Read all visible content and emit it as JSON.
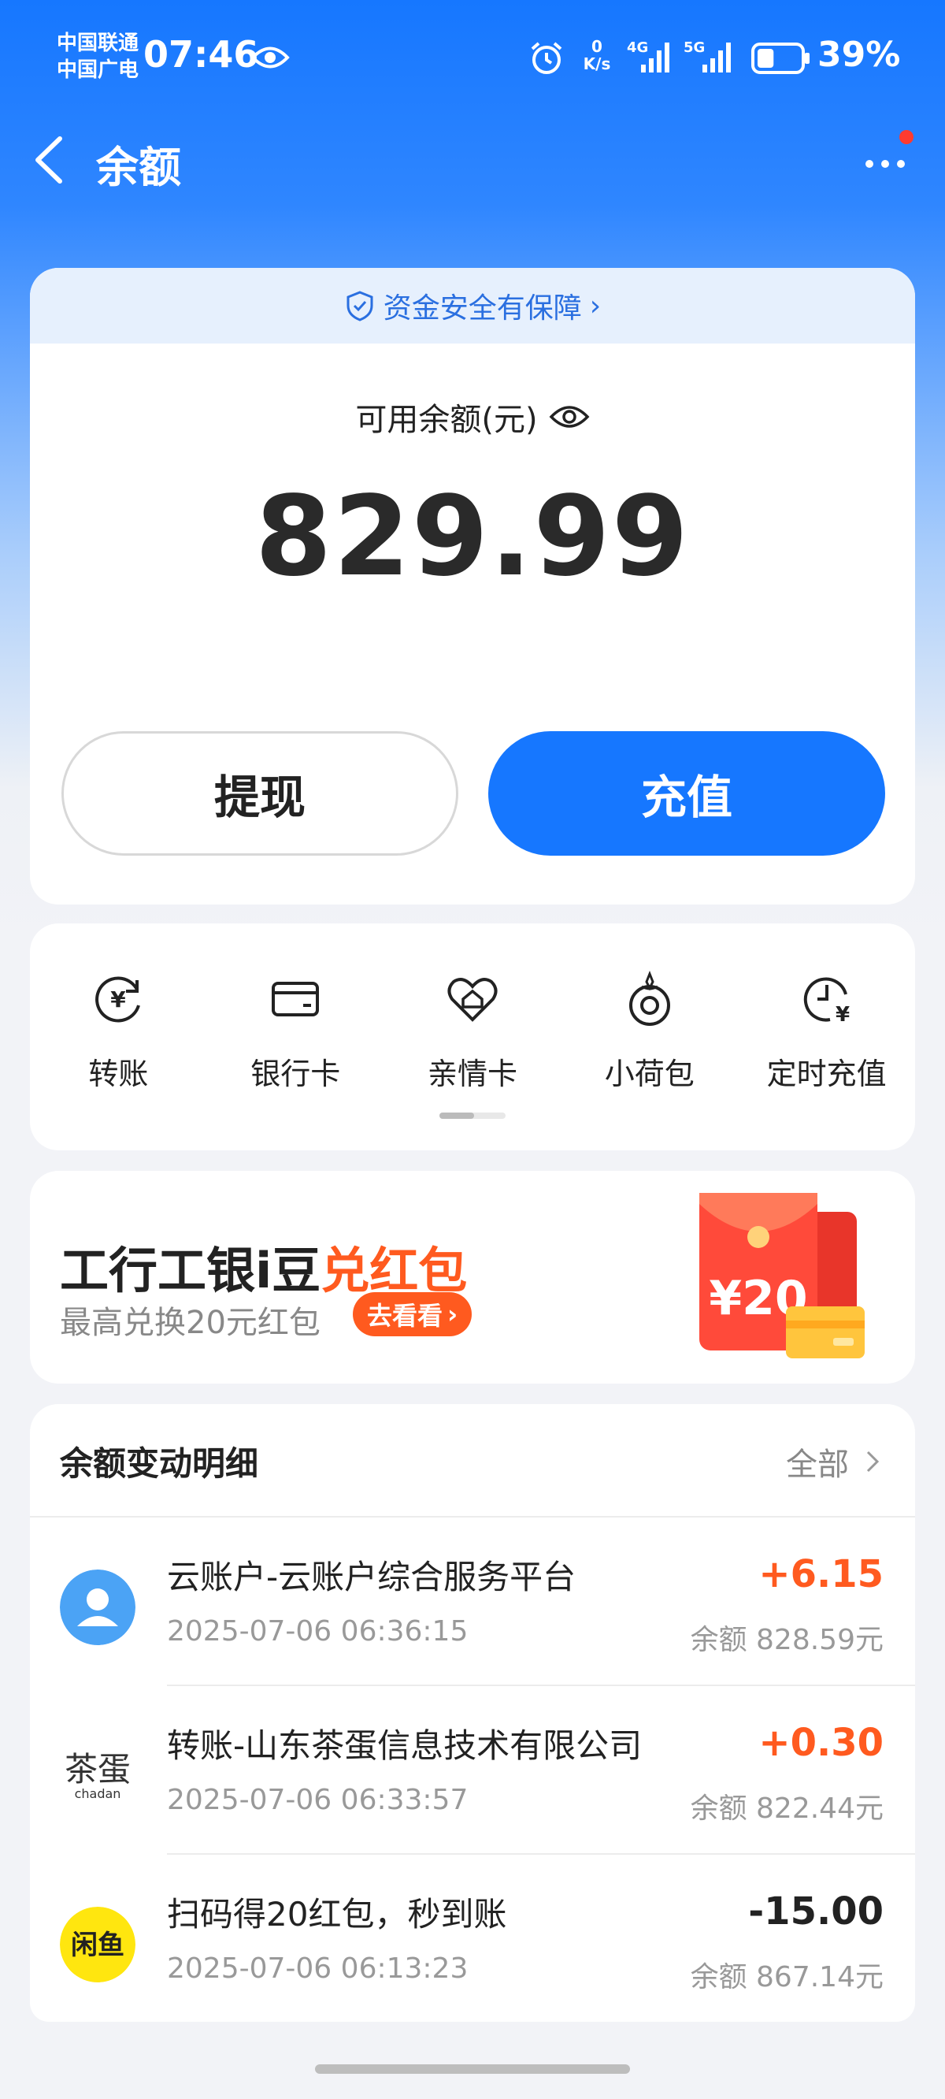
{
  "status_bar": {
    "carrier_1": "中国联通",
    "carrier_2": "中国广电",
    "time": "07:46",
    "net_speed_value": "0",
    "net_speed_unit": "K/s",
    "network_1": "4G",
    "network_2": "5G",
    "battery": "39%",
    "battery_level": 0.39
  },
  "nav": {
    "title": "余额",
    "back_icon": "back-chevron-icon",
    "more_icon": "more-dots-icon",
    "has_notification": true
  },
  "balance": {
    "security_label": "资金安全有保障",
    "label": "可用余额(元)",
    "amount": "829.99",
    "withdraw_label": "提现",
    "topup_label": "充值"
  },
  "actions": [
    {
      "label": "转账",
      "icon": "transfer-icon"
    },
    {
      "label": "银行卡",
      "icon": "bank-card-icon"
    },
    {
      "label": "亲情卡",
      "icon": "family-card-icon"
    },
    {
      "label": "小荷包",
      "icon": "small-purse-icon"
    },
    {
      "label": "定时充值",
      "icon": "scheduled-topup-icon"
    }
  ],
  "promo": {
    "title_main": "工行工银i豆",
    "title_highlight": "兑红包",
    "subtitle": "最高兑换20元红包",
    "cta": "去看看",
    "envelope_amount": "¥20"
  },
  "transactions": {
    "header": "余额变动明细",
    "all_label": "全部",
    "items": [
      {
        "title": "云账户-云账户综合服务平台",
        "time": "2025-07-06 06:36:15",
        "amount": "+6.15",
        "balance": "余额 828.59元",
        "direction": "in"
      },
      {
        "title": "转账-山东茶蛋信息技术有限公司",
        "time": "2025-07-06 06:33:57",
        "amount": "+0.30",
        "balance": "余额 822.44元",
        "direction": "in",
        "avatar_text": "茶蛋",
        "avatar_subtext": "chadan"
      },
      {
        "title": "扫码得20红包，秒到账",
        "time": "2025-07-06 06:13:23",
        "amount": "-15.00",
        "balance": "余额 867.14元",
        "direction": "out",
        "avatar_text": "闲鱼"
      }
    ]
  },
  "colors": {
    "primary": "#1677ff",
    "accent": "#ff5a1f"
  }
}
